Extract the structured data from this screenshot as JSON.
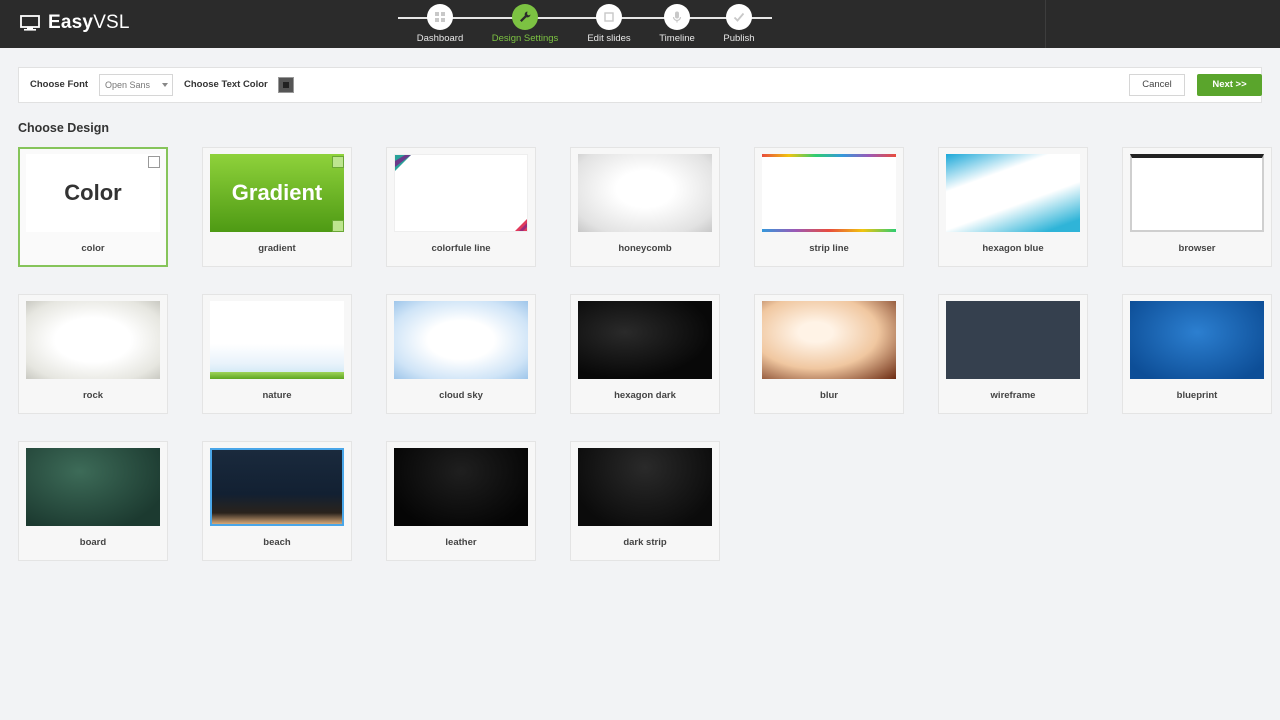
{
  "app": {
    "brand_bold": "Easy",
    "brand_regular": "VSL"
  },
  "steps": [
    {
      "label": "Dashboard",
      "icon": "grid-icon",
      "active": false
    },
    {
      "label": "Design Settings",
      "icon": "wrench-icon",
      "active": true
    },
    {
      "label": "Edit slides",
      "icon": "square-icon",
      "active": false
    },
    {
      "label": "Timeline",
      "icon": "microphone-icon",
      "active": false
    },
    {
      "label": "Publish",
      "icon": "check-icon",
      "active": false
    }
  ],
  "toolbar": {
    "font_label": "Choose Font",
    "font_value": "Open Sans",
    "text_color_label": "Choose Text Color",
    "text_color": "#222222",
    "cancel_label": "Cancel",
    "next_label": "Next >>"
  },
  "section": {
    "title": "Choose Design"
  },
  "designs": [
    {
      "label": "color",
      "thumb_text": "Color",
      "selected": true
    },
    {
      "label": "gradient",
      "thumb_text": "Gradient"
    },
    {
      "label": "colorfule line"
    },
    {
      "label": "honeycomb"
    },
    {
      "label": "strip line"
    },
    {
      "label": "hexagon blue"
    },
    {
      "label": "browser"
    },
    {
      "label": "rock"
    },
    {
      "label": "nature"
    },
    {
      "label": "cloud sky"
    },
    {
      "label": "hexagon dark"
    },
    {
      "label": "blur"
    },
    {
      "label": "wireframe"
    },
    {
      "label": "blueprint"
    },
    {
      "label": "board"
    },
    {
      "label": "beach"
    },
    {
      "label": "leather"
    },
    {
      "label": "dark strip"
    }
  ],
  "colors": {
    "accent": "#7cc242",
    "next_button": "#5aa52c",
    "topbar": "#2b2b2b"
  }
}
